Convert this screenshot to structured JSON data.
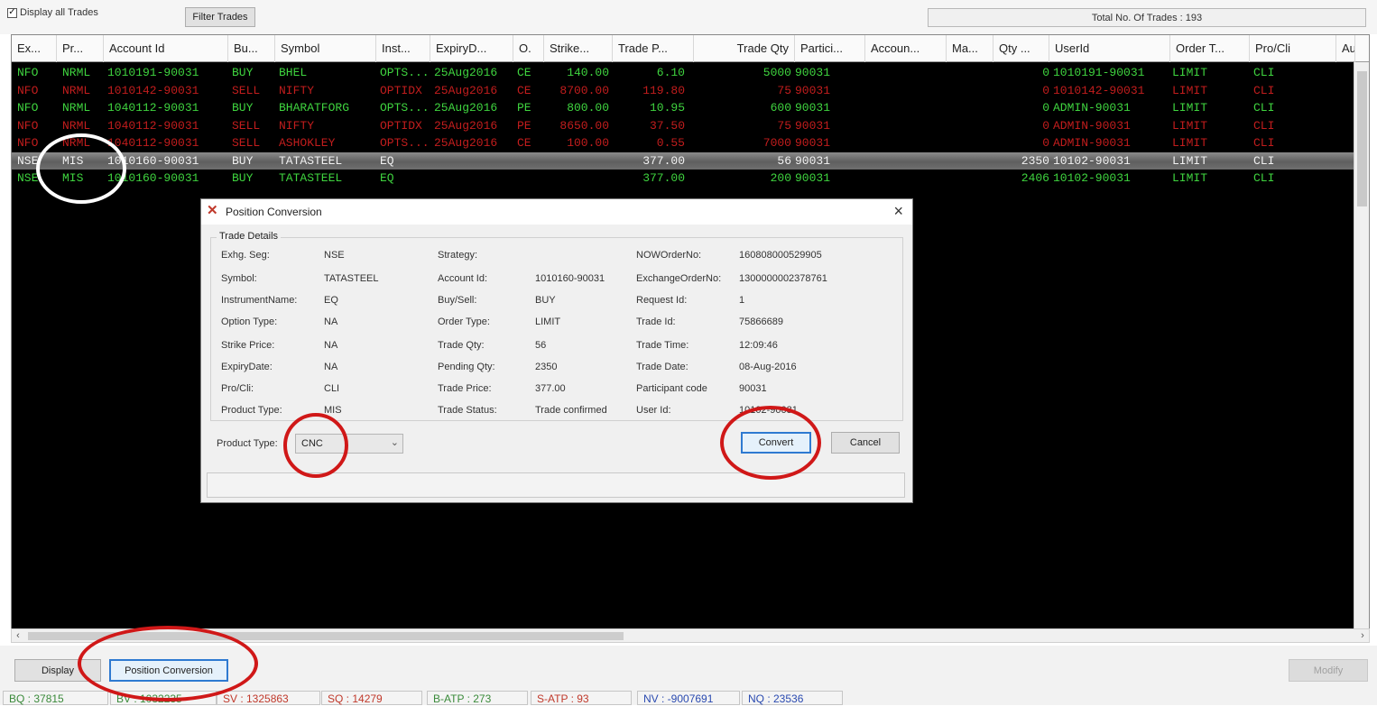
{
  "toolbar": {
    "display_all_label": "Display all Trades",
    "filter_label": "Filter Trades",
    "total_trades": "Total No. Of Trades : 193"
  },
  "columns": [
    "Ex...",
    "Pr...",
    "Account Id",
    "Bu...",
    "Symbol",
    "Inst...",
    "ExpiryD...",
    "O.",
    "Strike...",
    "Trade P...",
    "Trade Qty",
    "Partici...",
    "Accoun...",
    "Ma...",
    "Qty ...",
    "UserId",
    "Order T...",
    "Pro/Cli",
    "Au"
  ],
  "trades": [
    {
      "color": "green",
      "cells": [
        "NFO",
        "NRML",
        "1010191-90031",
        "BUY",
        "BHEL",
        "OPTS...",
        "25Aug2016",
        "CE",
        "140.00",
        "6.10",
        "5000",
        "90031",
        "",
        "",
        "0",
        "1010191-90031",
        "LIMIT",
        "CLI"
      ]
    },
    {
      "color": "red",
      "cells": [
        "NFO",
        "NRML",
        "1010142-90031",
        "SELL",
        "NIFTY",
        "OPTIDX",
        "25Aug2016",
        "CE",
        "8700.00",
        "119.80",
        "75",
        "90031",
        "",
        "",
        "0",
        "1010142-90031",
        "LIMIT",
        "CLI"
      ]
    },
    {
      "color": "green",
      "cells": [
        "NFO",
        "NRML",
        "1040112-90031",
        "BUY",
        "BHARATFORG",
        "OPTS...",
        "25Aug2016",
        "PE",
        "800.00",
        "10.95",
        "600",
        "90031",
        "",
        "",
        "0",
        "ADMIN-90031",
        "LIMIT",
        "CLI"
      ]
    },
    {
      "color": "red",
      "cells": [
        "NFO",
        "NRML",
        "1040112-90031",
        "SELL",
        "NIFTY",
        "OPTIDX",
        "25Aug2016",
        "PE",
        "8650.00",
        "37.50",
        "75",
        "90031",
        "",
        "",
        "0",
        "ADMIN-90031",
        "LIMIT",
        "CLI"
      ]
    },
    {
      "color": "red",
      "cells": [
        "NFO",
        "NRML",
        "1040112-90031",
        "SELL",
        "ASHOKLEY",
        "OPTS...",
        "25Aug2016",
        "CE",
        "100.00",
        "0.55",
        "7000",
        "90031",
        "",
        "",
        "0",
        "ADMIN-90031",
        "LIMIT",
        "CLI"
      ]
    },
    {
      "color": "selected",
      "cells": [
        "NSE",
        "MIS",
        "1010160-90031",
        "BUY",
        "TATASTEEL",
        "EQ",
        "",
        "",
        "",
        "377.00",
        "56",
        "90031",
        "",
        "",
        "2350",
        "10102-90031",
        "LIMIT",
        "CLI"
      ]
    },
    {
      "color": "green",
      "cells": [
        "NSE",
        "MIS",
        "1010160-90031",
        "BUY",
        "TATASTEEL",
        "EQ",
        "",
        "",
        "",
        "377.00",
        "200",
        "90031",
        "",
        "",
        "2406",
        "10102-90031",
        "LIMIT",
        "CLI"
      ]
    }
  ],
  "dialog": {
    "title": "Position Conversion",
    "group_label": "Trade Details",
    "fields": [
      {
        "label": "Exhg. Seg:",
        "value": "NSE"
      },
      {
        "label": "Symbol:",
        "value": "TATASTEEL"
      },
      {
        "label": "InstrumentName:",
        "value": "EQ"
      },
      {
        "label": "Option Type:",
        "value": "NA"
      },
      {
        "label": "Strike Price:",
        "value": "NA"
      },
      {
        "label": "ExpiryDate:",
        "value": "NA"
      },
      {
        "label": "Pro/Cli:",
        "value": "CLI"
      },
      {
        "label": "Product Type:",
        "value": "MIS"
      },
      {
        "label": "Strategy:",
        "value": ""
      },
      {
        "label": "Account Id:",
        "value": "1010160-90031"
      },
      {
        "label": "Buy/Sell:",
        "value": "BUY"
      },
      {
        "label": "Order Type:",
        "value": "LIMIT"
      },
      {
        "label": "Trade Qty:",
        "value": "56"
      },
      {
        "label": "Pending Qty:",
        "value": "2350"
      },
      {
        "label": "Trade Price:",
        "value": "377.00"
      },
      {
        "label": "Trade Status:",
        "value": "Trade confirmed"
      },
      {
        "label": "NOWOrderNo:",
        "value": "160808000529905"
      },
      {
        "label": "ExchangeOrderNo:",
        "value": "1300000002378761"
      },
      {
        "label": "Request Id:",
        "value": "1"
      },
      {
        "label": "Trade Id:",
        "value": "75866689"
      },
      {
        "label": "Trade Time:",
        "value": "12:09:46"
      },
      {
        "label": "Trade Date:",
        "value": "08-Aug-2016"
      },
      {
        "label": "Participant code",
        "value": "90031"
      },
      {
        "label": "User Id:",
        "value": "10102-90031"
      }
    ],
    "product_type_label": "Product Type:",
    "product_type_value": "CNC",
    "convert_label": "Convert",
    "cancel_label": "Cancel"
  },
  "bottom": {
    "display_label": "Display",
    "position_conversion_label": "Position Conversion",
    "modify_label": "Modify"
  },
  "status": [
    {
      "text": "BQ : 37815",
      "color": "#3a8a3a"
    },
    {
      "text": "BV : 1032235",
      "color": "#3a8a3a"
    },
    {
      "text": "SV : 1325863",
      "color": "#c0392b"
    },
    {
      "text": "SQ : 14279",
      "color": "#c0392b"
    },
    {
      "text": "B-ATP : 273",
      "color": "#3a8a3a"
    },
    {
      "text": "S-ATP : 93",
      "color": "#c0392b"
    },
    {
      "text": "NV : -9007691",
      "color": "#2a4ab0"
    },
    {
      "text": "NQ : 23536",
      "color": "#2a4ab0"
    }
  ]
}
